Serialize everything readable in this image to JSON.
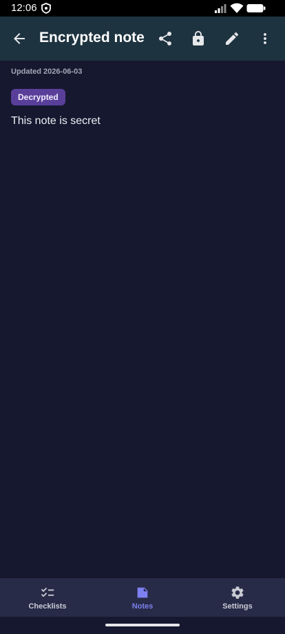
{
  "status_bar": {
    "time": "12:06",
    "icons": [
      "shield-icon",
      "signal-icon",
      "wifi-icon",
      "battery-icon"
    ]
  },
  "app_bar": {
    "title": "Encrypted note",
    "actions": [
      "back-arrow-icon",
      "share-icon",
      "lock-icon",
      "edit-pencil-icon",
      "more-vertical-icon"
    ]
  },
  "note": {
    "updated": "Updated 2026-06-03",
    "badge": "Decrypted",
    "body": "This note is secret"
  },
  "bottom_nav": {
    "items": [
      {
        "label": "Checklists",
        "icon": "checklist-icon",
        "active": false
      },
      {
        "label": "Notes",
        "icon": "note-icon",
        "active": true
      },
      {
        "label": "Settings",
        "icon": "gear-icon",
        "active": false
      }
    ]
  },
  "colors": {
    "background": "#161830",
    "app_bar": "#1e3340",
    "badge": "#5a3f9a",
    "nav_bar": "#272b47",
    "nav_active": "#7d80f0"
  }
}
